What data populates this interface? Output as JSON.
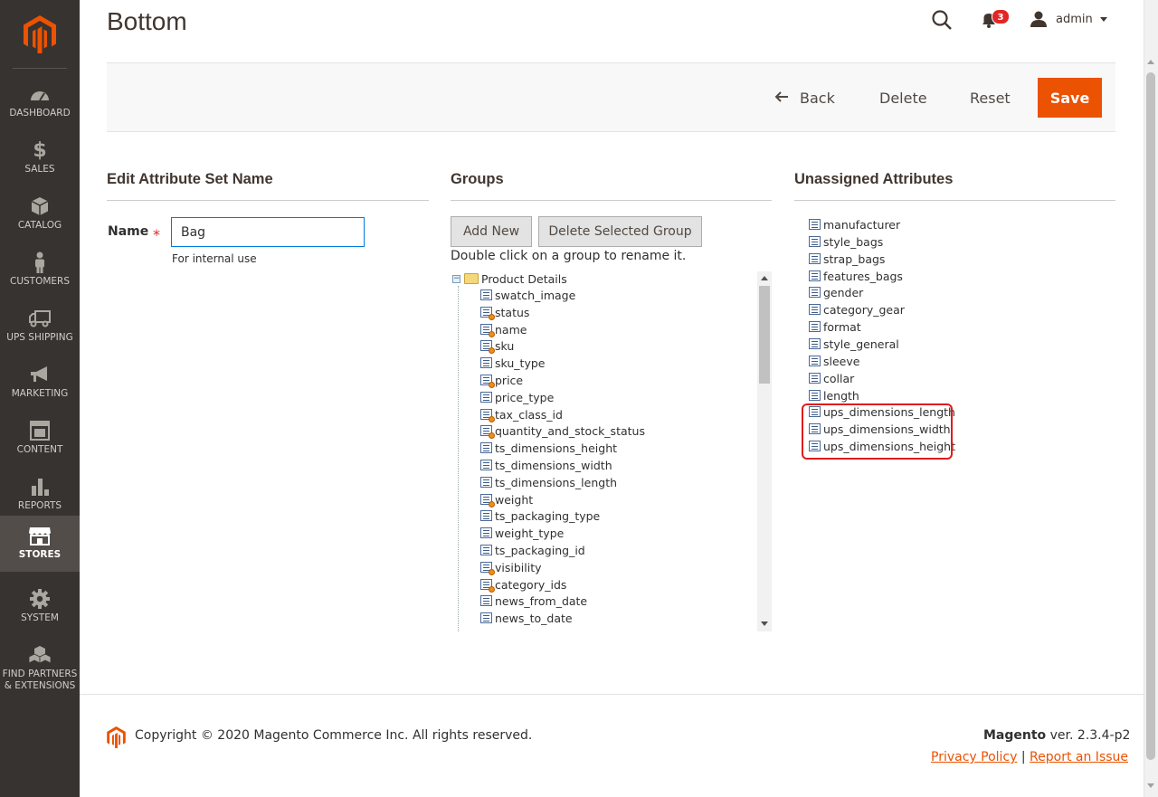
{
  "sidebar": {
    "items": [
      {
        "label": "DASHBOARD",
        "icon": "dashboard-icon"
      },
      {
        "label": "SALES",
        "icon": "dollar-icon"
      },
      {
        "label": "CATALOG",
        "icon": "box-icon"
      },
      {
        "label": "CUSTOMERS",
        "icon": "person-icon"
      },
      {
        "label": "UPS SHIPPING",
        "icon": "truck-icon"
      },
      {
        "label": "MARKETING",
        "icon": "megaphone-icon"
      },
      {
        "label": "CONTENT",
        "icon": "layout-icon"
      },
      {
        "label": "REPORTS",
        "icon": "bar-chart-icon"
      },
      {
        "label": "STORES",
        "icon": "store-icon",
        "active": true
      },
      {
        "label": "SYSTEM",
        "icon": "gear-icon"
      },
      {
        "label": "FIND PARTNERS & EXTENSIONS",
        "icon": "cubes-icon"
      }
    ]
  },
  "header": {
    "title": "Bottom",
    "notifications_count": "3",
    "user": "admin"
  },
  "actions": {
    "back": "Back",
    "delete": "Delete",
    "reset": "Reset",
    "save": "Save"
  },
  "edit_name": {
    "title": "Edit Attribute Set Name",
    "label": "Name",
    "required": "*",
    "value": "Bag",
    "note": "For internal use"
  },
  "groups": {
    "title": "Groups",
    "add_new": "Add New",
    "delete_selected": "Delete Selected Group",
    "hint": "Double click on a group to rename it.",
    "group_name": "Product Details",
    "items": [
      {
        "name": "swatch_image",
        "system": false
      },
      {
        "name": "status",
        "system": true
      },
      {
        "name": "name",
        "system": true
      },
      {
        "name": "sku",
        "system": true
      },
      {
        "name": "sku_type",
        "system": false
      },
      {
        "name": "price",
        "system": true
      },
      {
        "name": "price_type",
        "system": false
      },
      {
        "name": "tax_class_id",
        "system": true
      },
      {
        "name": "quantity_and_stock_status",
        "system": true
      },
      {
        "name": "ts_dimensions_height",
        "system": false
      },
      {
        "name": "ts_dimensions_width",
        "system": false
      },
      {
        "name": "ts_dimensions_length",
        "system": false
      },
      {
        "name": "weight",
        "system": true
      },
      {
        "name": "ts_packaging_type",
        "system": false
      },
      {
        "name": "weight_type",
        "system": false
      },
      {
        "name": "ts_packaging_id",
        "system": false
      },
      {
        "name": "visibility",
        "system": true
      },
      {
        "name": "category_ids",
        "system": true
      },
      {
        "name": "news_from_date",
        "system": false
      },
      {
        "name": "news_to_date",
        "system": false
      }
    ]
  },
  "unassigned": {
    "title": "Unassigned Attributes",
    "items": [
      "manufacturer",
      "style_bags",
      "strap_bags",
      "features_bags",
      "gender",
      "category_gear",
      "format",
      "style_general",
      "sleeve",
      "collar",
      "length",
      "ups_dimensions_length",
      "ups_dimensions_width",
      "ups_dimensions_height"
    ]
  },
  "footer": {
    "copyright": "Copyright © 2020 Magento Commerce Inc. All rights reserved.",
    "brand": "Magento",
    "version": " ver. 2.3.4-p2",
    "privacy": "Privacy Policy",
    "separator": " | ",
    "report": "Report an Issue"
  },
  "colors": {
    "accent": "#eb5202",
    "sidebar_bg": "#373330",
    "highlight": "#e21b1b"
  }
}
